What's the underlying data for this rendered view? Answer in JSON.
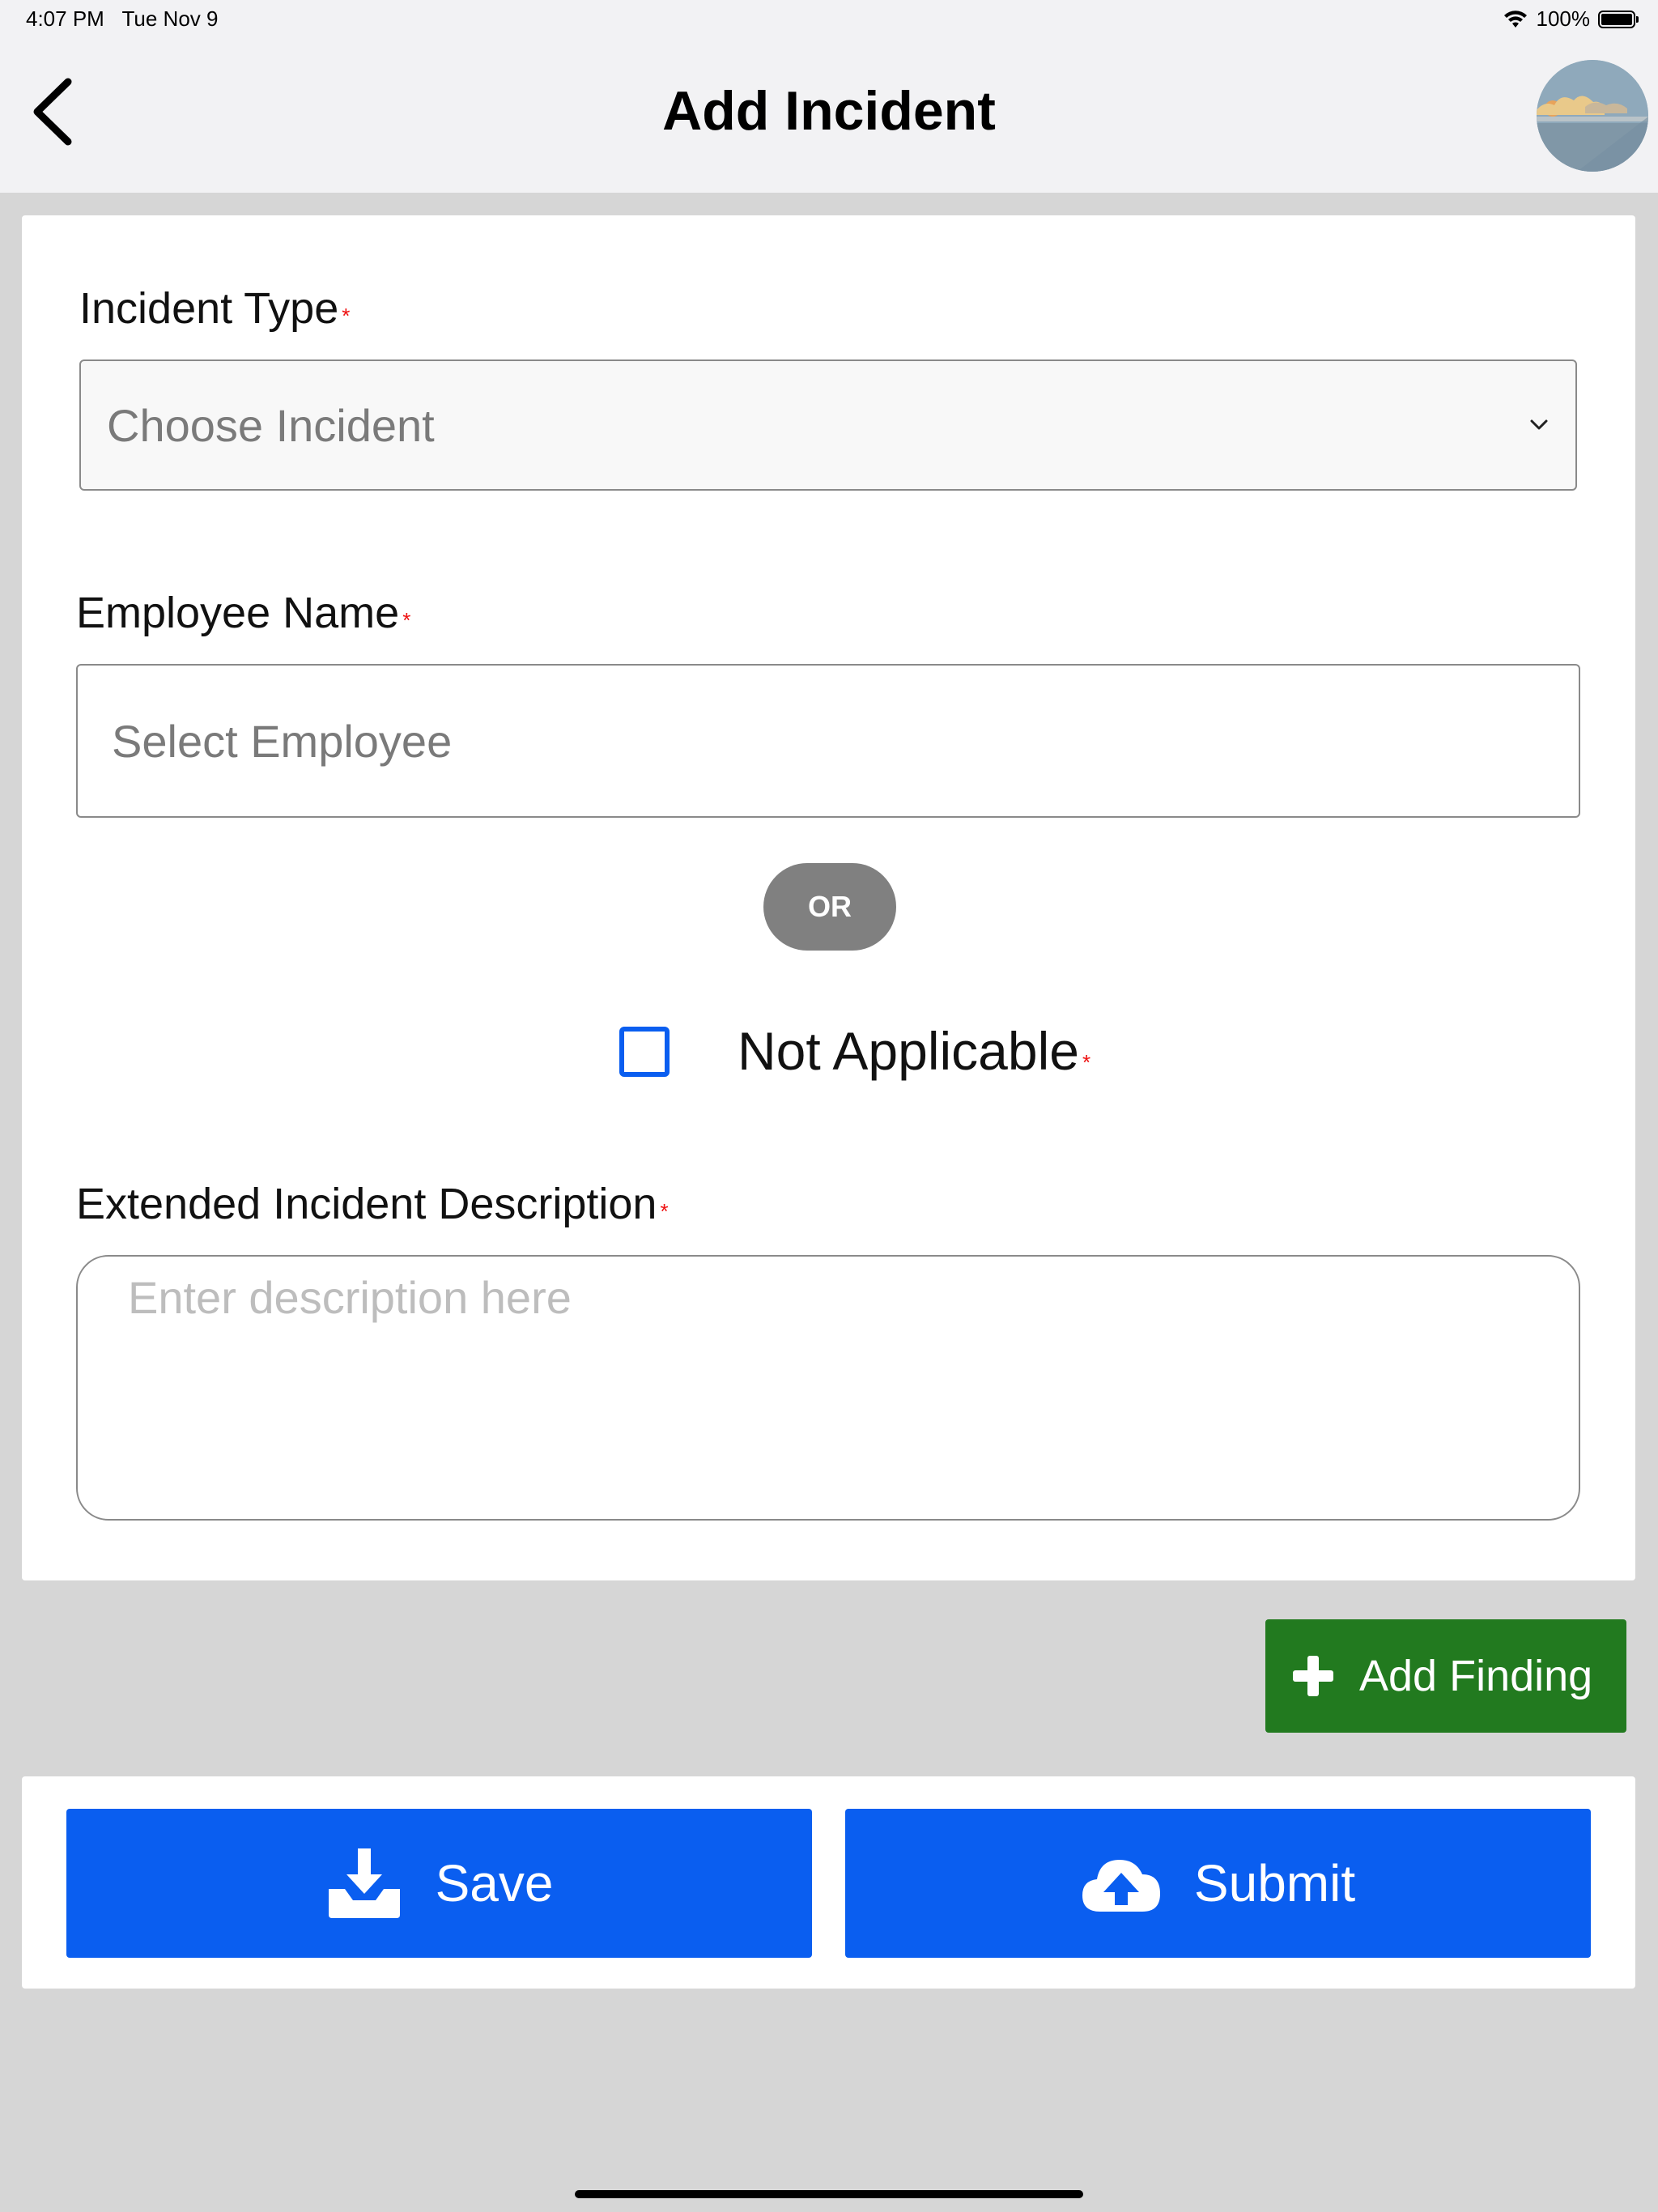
{
  "status_bar": {
    "time": "4:07 PM",
    "date": "Tue Nov 9",
    "battery": "100%"
  },
  "header": {
    "title": "Add Incident",
    "back_icon": "chevron-left-icon",
    "avatar": "user-avatar"
  },
  "form": {
    "incident_type": {
      "label": "Incident Type",
      "required_mark": "*",
      "placeholder": "Choose Incident"
    },
    "employee_name": {
      "label": "Employee Name",
      "required_mark": "*",
      "placeholder": "Select Employee"
    },
    "or_label": "OR",
    "not_applicable": {
      "label": "Not Applicable",
      "required_mark": "*",
      "checked": false
    },
    "description": {
      "label": "Extended Incident Description",
      "required_mark": "*",
      "placeholder": "Enter description here"
    }
  },
  "buttons": {
    "add_finding": "Add Finding",
    "save": "Save",
    "submit": "Submit"
  },
  "colors": {
    "primary_blue": "#0a5ef0",
    "add_green": "#227a1f",
    "required_red": "#e11111",
    "background_gray": "#d6d6d6"
  }
}
